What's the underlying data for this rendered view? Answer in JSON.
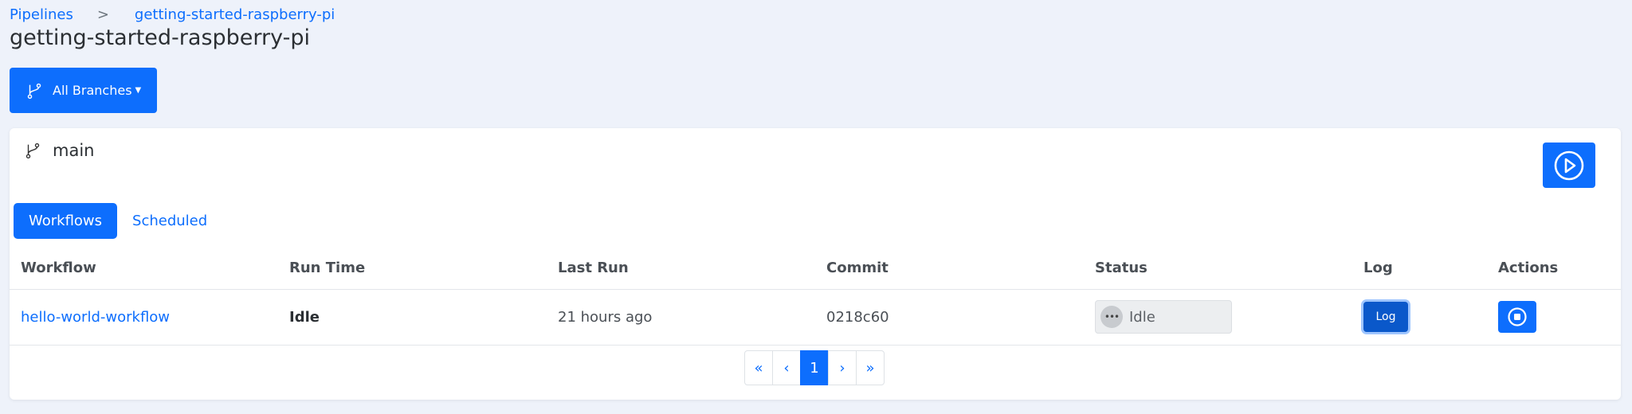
{
  "breadcrumb": {
    "root": "Pipelines",
    "separator": ">",
    "current": "getting-started-raspberry-pi"
  },
  "page_title": "getting-started-raspberry-pi",
  "branch_filter": {
    "label": "All Branches",
    "icon": "git-branch-icon"
  },
  "branch": {
    "name": "main",
    "icon": "git-branch-icon"
  },
  "run_button": {
    "icon": "play-circle-icon"
  },
  "tabs": [
    {
      "label": "Workflows",
      "active": true
    },
    {
      "label": "Scheduled",
      "active": false
    }
  ],
  "table": {
    "headers": [
      "Workflow",
      "Run Time",
      "Last Run",
      "Commit",
      "Status",
      "Log",
      "Actions"
    ],
    "rows": [
      {
        "workflow": "hello-world-workflow",
        "run_time": "Idle",
        "last_run": "21 hours ago",
        "commit": "0218c60",
        "status": "Idle",
        "log_label": "Log",
        "action_icon": "stop-circle-icon"
      }
    ]
  },
  "pagination": {
    "first": "«",
    "prev": "‹",
    "current": "1",
    "next": "›",
    "last": "»"
  },
  "colors": {
    "primary": "#0d6efd",
    "background": "#eef2fa"
  }
}
